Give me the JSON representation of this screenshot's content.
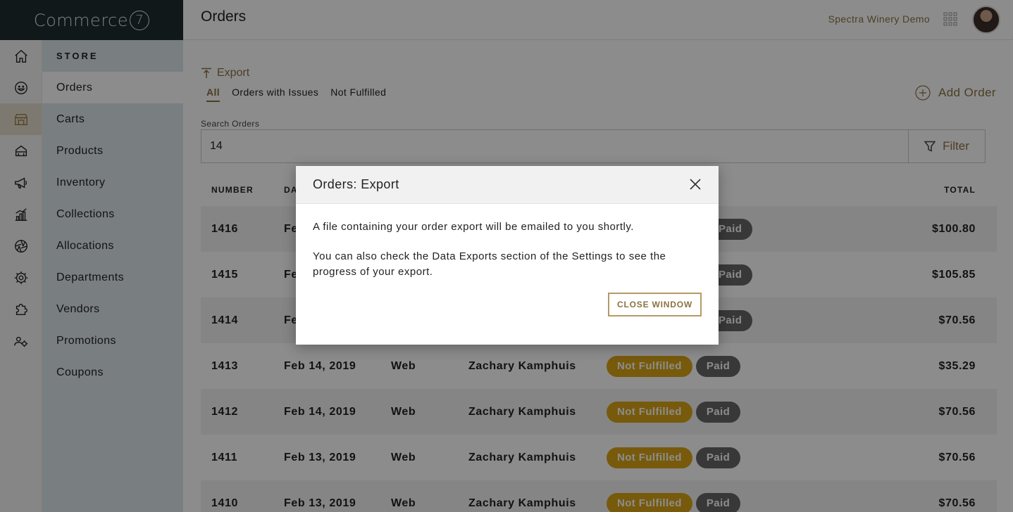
{
  "brand": {
    "name": "Commerce",
    "mark": "7"
  },
  "header": {
    "title": "Orders",
    "account": "Spectra Winery Demo",
    "apps_icon": "grid-icon",
    "avatar_icon": "user-avatar"
  },
  "rail": {
    "items": [
      {
        "icon": "home-icon"
      },
      {
        "icon": "smiley-icon"
      },
      {
        "icon": "store-icon",
        "active": true
      },
      {
        "icon": "wine-club-icon"
      },
      {
        "icon": "megaphone-icon"
      },
      {
        "icon": "reports-icon"
      },
      {
        "icon": "aperture-icon"
      },
      {
        "icon": "gear-icon"
      },
      {
        "icon": "puzzle-icon"
      },
      {
        "icon": "people-gear-icon"
      }
    ]
  },
  "subnav": {
    "heading": "STORE",
    "items": [
      {
        "label": "Orders",
        "active": true
      },
      {
        "label": "Carts"
      },
      {
        "label": "Products"
      },
      {
        "label": "Inventory"
      },
      {
        "label": "Collections"
      },
      {
        "label": "Allocations"
      },
      {
        "label": "Departments"
      },
      {
        "label": "Vendors"
      },
      {
        "label": "Promotions"
      },
      {
        "label": "Coupons"
      }
    ]
  },
  "toolbar": {
    "export_label": "Export",
    "add_order_label": "Add Order",
    "filter_label": "Filter"
  },
  "tabs": [
    {
      "label": "All",
      "active": true
    },
    {
      "label": "Orders with Issues"
    },
    {
      "label": "Not Fulfilled"
    }
  ],
  "search": {
    "label": "Search Orders",
    "value": "14"
  },
  "table": {
    "headers": {
      "number": "NUMBER",
      "date": "DA",
      "total": "TOTAL"
    },
    "rows": [
      {
        "number": "1416",
        "date": "Fe",
        "channel": "",
        "customer": "",
        "fulfillment": "",
        "payment": "Paid",
        "total": "$100.80"
      },
      {
        "number": "1415",
        "date": "Fe",
        "channel": "",
        "customer": "",
        "fulfillment": "",
        "payment": "Paid",
        "total": "$105.85"
      },
      {
        "number": "1414",
        "date": "Fe",
        "channel": "",
        "customer": "",
        "fulfillment": "",
        "payment": "Paid",
        "total": "$70.56"
      },
      {
        "number": "1413",
        "date": "Feb 14, 2019",
        "channel": "Web",
        "customer": "Zachary Kamphuis",
        "fulfillment": "Not Fulfilled",
        "payment": "Paid",
        "total": "$35.29"
      },
      {
        "number": "1412",
        "date": "Feb 14, 2019",
        "channel": "Web",
        "customer": "Zachary Kamphuis",
        "fulfillment": "Not Fulfilled",
        "payment": "Paid",
        "total": "$70.56"
      },
      {
        "number": "1411",
        "date": "Feb 13, 2019",
        "channel": "Web",
        "customer": "Zachary Kamphuis",
        "fulfillment": "Not Fulfilled",
        "payment": "Paid",
        "total": "$70.56"
      },
      {
        "number": "1410",
        "date": "Feb 13, 2019",
        "channel": "Web",
        "customer": "Zachary Kamphuis",
        "fulfillment": "Not Fulfilled",
        "payment": "Paid",
        "total": "$70.56"
      }
    ]
  },
  "modal": {
    "title": "Orders: Export",
    "line1": "A file containing your order export will be emailed to you shortly.",
    "line2": "You can also check the Data Exports section of the Settings to see the progress of your export.",
    "close_button": "CLOSE WINDOW"
  },
  "colors": {
    "accent": "#8b7242",
    "sidebar_dark": "#1e2c2f",
    "subnav_bg": "#dde5ea",
    "not_fulfilled": "#d9a514",
    "paid": "#666666"
  }
}
